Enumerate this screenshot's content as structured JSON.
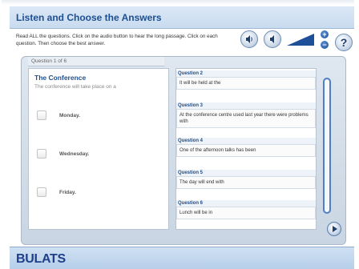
{
  "header": {
    "title": "Listen and Choose the Answers"
  },
  "instructions": "Read ALL the questions. Click on the audio button to hear the long passage. Click on each question. Then choose the best answer.",
  "controls": {
    "play_icon": "speaker-icon",
    "replay_icon": "speaker-icon",
    "volume_plus": "+",
    "volume_minus": "−",
    "help_label": "?"
  },
  "question_tab": "Question 1 of 6",
  "current_question": {
    "title": "The Conference",
    "stem": "The conference will take place on a",
    "options": [
      "Monday.",
      "Wednesday.",
      "Friday."
    ]
  },
  "questions": [
    {
      "label": "Question 2",
      "text": "It will be held at the"
    },
    {
      "label": "Question 3",
      "text": "At the conference centre used last year there were problems with"
    },
    {
      "label": "Question 4",
      "text": "One of the afternoon talks has been"
    },
    {
      "label": "Question 5",
      "text": "The day will end with"
    },
    {
      "label": "Question 6",
      "text": "Lunch will be in"
    }
  ],
  "footer": {
    "brand": "BULATS"
  }
}
